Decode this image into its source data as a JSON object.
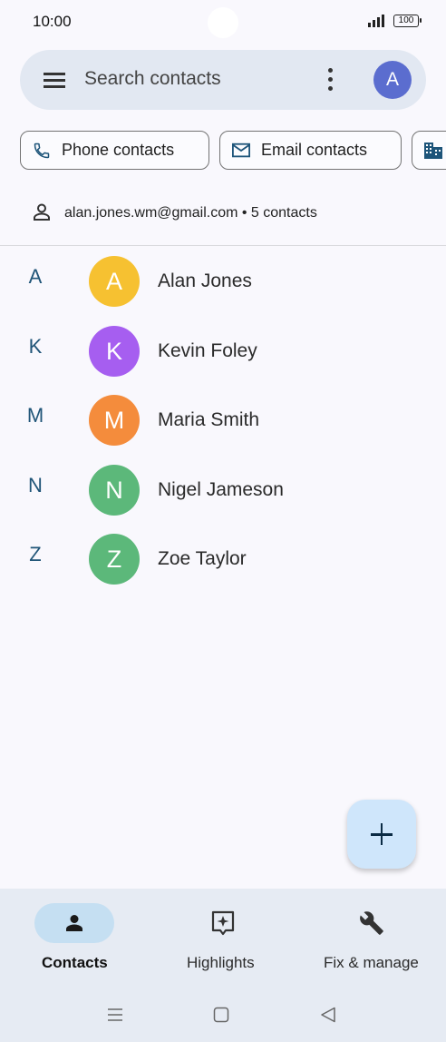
{
  "status_bar": {
    "time": "10:00",
    "battery": "100",
    "icons": [
      "signal-icon",
      "battery-icon"
    ]
  },
  "search": {
    "placeholder": "Search contacts",
    "account_initial": "A",
    "account_color": "#5b6dcf"
  },
  "chips": [
    {
      "label": "Phone contacts",
      "icon": "phone-icon"
    },
    {
      "label": "Email contacts",
      "icon": "email-icon"
    },
    {
      "label": "",
      "icon": "business-icon"
    }
  ],
  "account": {
    "summary": "alan.jones.wm@gmail.com • 5 contacts",
    "icon": "person-outline-icon"
  },
  "contacts": [
    {
      "letter": "A",
      "initial": "A",
      "name": "Alan Jones",
      "color": "#f6c131"
    },
    {
      "letter": "K",
      "initial": "K",
      "name": "Kevin Foley",
      "color": "#a65ef0"
    },
    {
      "letter": "M",
      "initial": "M",
      "name": "Maria Smith",
      "color": "#f48c3c"
    },
    {
      "letter": "N",
      "initial": "N",
      "name": "Nigel Jameson",
      "color": "#5cb87a"
    },
    {
      "letter": "Z",
      "initial": "Z",
      "name": "Zoe Taylor",
      "color": "#5cb87a"
    }
  ],
  "fab": {
    "icon": "add-icon"
  },
  "bottom_nav": {
    "items": [
      {
        "label": "Contacts",
        "icon": "person-icon",
        "active": true
      },
      {
        "label": "Highlights",
        "icon": "highlights-icon",
        "active": false
      },
      {
        "label": "Fix & manage",
        "icon": "wrench-icon",
        "active": false
      }
    ]
  },
  "colors": {
    "background": "#f9f8fd",
    "search_bar": "#e2e8f2",
    "letter_header": "#205578",
    "fab": "#cfe6fb",
    "nav_active_pill": "#c5dff2"
  }
}
